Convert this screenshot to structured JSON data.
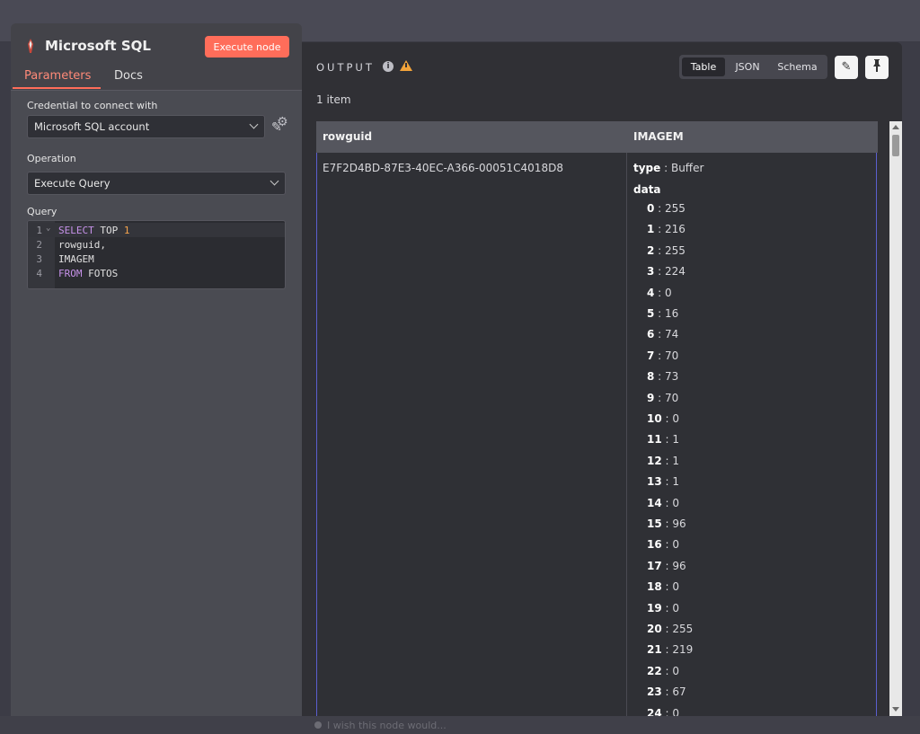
{
  "node": {
    "title": "Microsoft SQL",
    "execute_label": "Execute node",
    "tabs": [
      {
        "label": "Parameters",
        "active": true
      },
      {
        "label": "Docs",
        "active": false
      }
    ],
    "credential": {
      "label": "Credential to connect with",
      "value": "Microsoft SQL account"
    },
    "operation": {
      "label": "Operation",
      "value": "Execute Query"
    },
    "query": {
      "label": "Query",
      "lines": [
        {
          "num": "1",
          "tokens": [
            {
              "t": "SELECT",
              "c": "kw"
            },
            {
              "t": " TOP ",
              "c": ""
            },
            {
              "t": "1",
              "c": "num"
            }
          ]
        },
        {
          "num": "2",
          "tokens": [
            {
              "t": "rowguid,",
              "c": ""
            }
          ]
        },
        {
          "num": "3",
          "tokens": [
            {
              "t": "IMAGEM",
              "c": ""
            }
          ]
        },
        {
          "num": "4",
          "tokens": [
            {
              "t": "FROM",
              "c": "kw"
            },
            {
              "t": " FOTOS",
              "c": ""
            }
          ]
        }
      ]
    }
  },
  "output": {
    "title": "OUTPUT",
    "views": [
      {
        "label": "Table",
        "active": true
      },
      {
        "label": "JSON",
        "active": false
      },
      {
        "label": "Schema",
        "active": false
      }
    ],
    "items_count": "1 item",
    "columns": [
      "rowguid",
      "IMAGEM"
    ],
    "row": {
      "rowguid": "E7F2D4BD-87E3-40EC-A366-00051C4018D8",
      "type_key": "type",
      "type_value": "Buffer",
      "data_key": "data",
      "data": [
        {
          "k": "0",
          "v": "255"
        },
        {
          "k": "1",
          "v": "216"
        },
        {
          "k": "2",
          "v": "255"
        },
        {
          "k": "3",
          "v": "224"
        },
        {
          "k": "4",
          "v": "0"
        },
        {
          "k": "5",
          "v": "16"
        },
        {
          "k": "6",
          "v": "74"
        },
        {
          "k": "7",
          "v": "70"
        },
        {
          "k": "8",
          "v": "73"
        },
        {
          "k": "9",
          "v": "70"
        },
        {
          "k": "10",
          "v": "0"
        },
        {
          "k": "11",
          "v": "1"
        },
        {
          "k": "12",
          "v": "1"
        },
        {
          "k": "13",
          "v": "1"
        },
        {
          "k": "14",
          "v": "0"
        },
        {
          "k": "15",
          "v": "96"
        },
        {
          "k": "16",
          "v": "0"
        },
        {
          "k": "17",
          "v": "96"
        },
        {
          "k": "18",
          "v": "0"
        },
        {
          "k": "19",
          "v": "0"
        },
        {
          "k": "20",
          "v": "255"
        },
        {
          "k": "21",
          "v": "219"
        },
        {
          "k": "22",
          "v": "0"
        },
        {
          "k": "23",
          "v": "67"
        },
        {
          "k": "24",
          "v": "0"
        }
      ]
    }
  },
  "feedback_placeholder": "I wish this node would...",
  "colors": {
    "accent": "#ff6d5a",
    "warning": "#f2a33a",
    "selection": "#5b5fcf"
  },
  "icons": {
    "settings": "gear-icon",
    "edit": "pencil-icon",
    "pin": "pin-icon",
    "info": "info-icon",
    "warning": "warning-icon"
  }
}
